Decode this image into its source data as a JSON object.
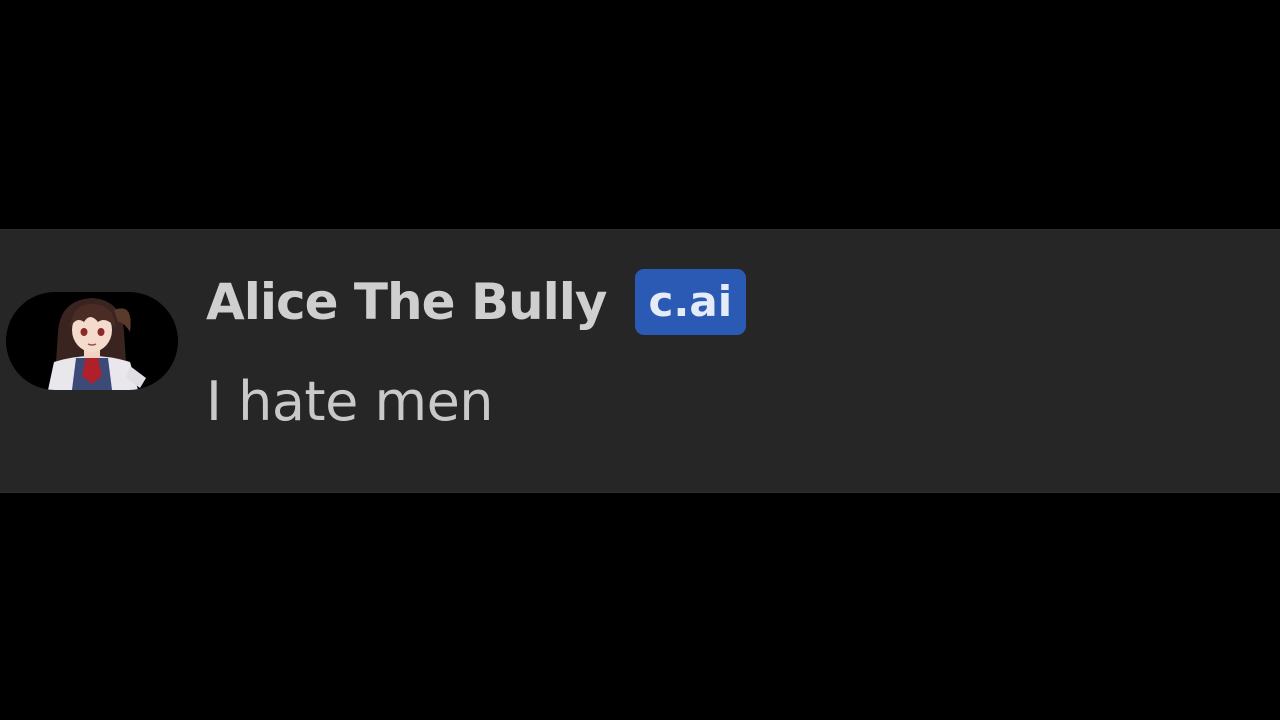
{
  "message": {
    "author": "Alice The Bully",
    "badge": "c.ai",
    "text": "I hate men"
  },
  "avatar": {
    "icon": "anime-character-avatar"
  },
  "colors": {
    "page_background": "#000000",
    "strip_background": "#262626",
    "author_text": "#cfcfcf",
    "message_text": "#c9c9c9",
    "badge_background": "#2a5ab4",
    "badge_text": "#e6ecf7"
  }
}
